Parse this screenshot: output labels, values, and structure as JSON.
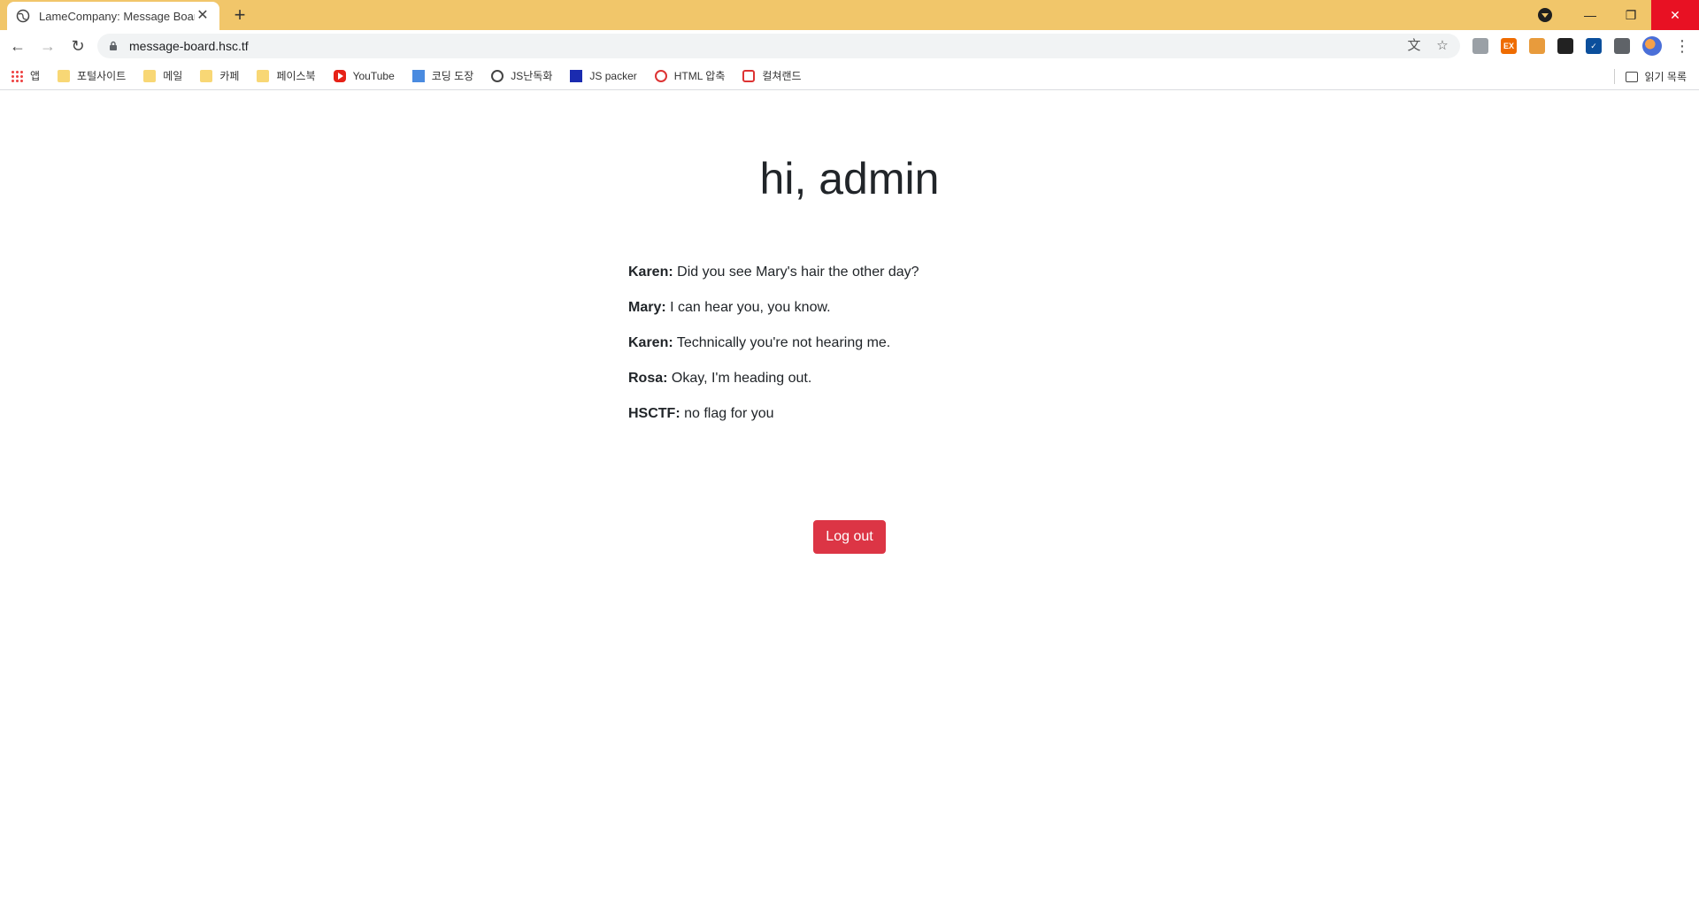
{
  "browser": {
    "tab_title": "LameCompany: Message Board",
    "tab_close": "✕",
    "new_tab": "+",
    "url": "message-board.hsc.tf",
    "back": "←",
    "forward": "→",
    "reload": "↻",
    "translate_icon": "文",
    "star_icon": "☆",
    "kebab": "⋮",
    "window": {
      "minimize": "—",
      "restore": "❐",
      "close": "✕"
    }
  },
  "extensions": [
    {
      "name": "cast-icon",
      "color": "#9aa0a6",
      "label": ""
    },
    {
      "name": "extension-orange-icon",
      "color": "#ef6c00",
      "label": "EX"
    },
    {
      "name": "cookie-icon",
      "color": "#e89b3c",
      "label": ""
    },
    {
      "name": "glasses-icon",
      "color": "#222222",
      "label": ""
    },
    {
      "name": "check-icon",
      "color": "#0b4f9c",
      "label": "✓"
    },
    {
      "name": "puzzle-icon",
      "color": "#5f6368",
      "label": ""
    }
  ],
  "bookmarks": {
    "items": [
      {
        "label": "앱",
        "icon": "apps-icon"
      },
      {
        "label": "포털사이트",
        "icon": "folder-icon"
      },
      {
        "label": "메일",
        "icon": "folder-icon"
      },
      {
        "label": "카페",
        "icon": "folder-icon"
      },
      {
        "label": "페이스북",
        "icon": "folder-icon"
      },
      {
        "label": "YouTube",
        "icon": "youtube-icon"
      },
      {
        "label": "코딩 도장",
        "icon": "codingdojang-icon"
      },
      {
        "label": "JS난독화",
        "icon": "globe-icon"
      },
      {
        "label": "JS packer",
        "icon": "jspacker-icon"
      },
      {
        "label": "HTML 압축",
        "icon": "html-compress-icon"
      },
      {
        "label": "컬쳐랜드",
        "icon": "cultureland-icon"
      }
    ],
    "reading_list": "읽기 목록"
  },
  "page": {
    "greeting": "hi, admin",
    "messages": [
      {
        "author": "Karen:",
        "text": "Did you see Mary's hair the other day?"
      },
      {
        "author": "Mary:",
        "text": "I can hear you, you know."
      },
      {
        "author": "Karen:",
        "text": "Technically you're not hearing me."
      },
      {
        "author": "Rosa:",
        "text": "Okay, I'm heading out."
      },
      {
        "author": "HSCTF:",
        "text": "no flag for you"
      }
    ],
    "logout_label": "Log out"
  }
}
